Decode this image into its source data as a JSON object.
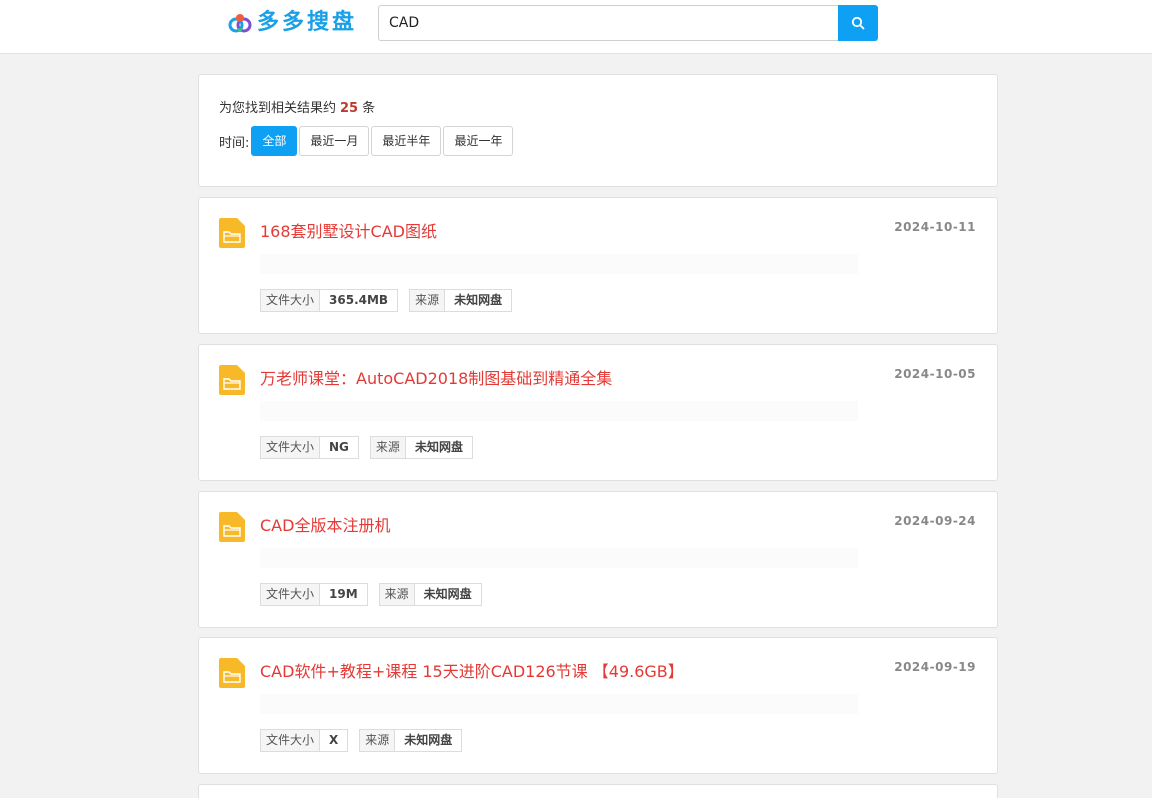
{
  "header": {
    "logo_text": "多多搜盘",
    "search_value": "CAD"
  },
  "summary": {
    "prefix": "为您找到相关结果约",
    "count": "25",
    "suffix": "条",
    "time_label": "时间:",
    "filters": [
      "全部",
      "最近一月",
      "最近半年",
      "最近一年"
    ],
    "active_filter": "全部"
  },
  "results": [
    {
      "title": "168套别墅设计CAD图纸",
      "date": "2024-10-11",
      "size_label": "文件大小",
      "size": "365.4MB",
      "source_label": "来源",
      "source": "未知网盘"
    },
    {
      "title": "万老师课堂：AutoCAD2018制图基础到精通全集",
      "date": "2024-10-05",
      "size_label": "文件大小",
      "size": "NG",
      "source_label": "来源",
      "source": "未知网盘"
    },
    {
      "title": "CAD全版本注册机",
      "date": "2024-09-24",
      "size_label": "文件大小",
      "size": "19M",
      "source_label": "来源",
      "source": "未知网盘"
    },
    {
      "title": "CAD软件+教程+课程 15天进阶CAD126节课 【49.6GB】",
      "date": "2024-09-19",
      "size_label": "文件大小",
      "size": "X",
      "source_label": "来源",
      "source": "未知网盘"
    }
  ],
  "colors": {
    "accent": "#0ea0f2",
    "title_red": "#e53935",
    "count_red": "#c0392b",
    "folder_yellow": "#f7b928"
  }
}
